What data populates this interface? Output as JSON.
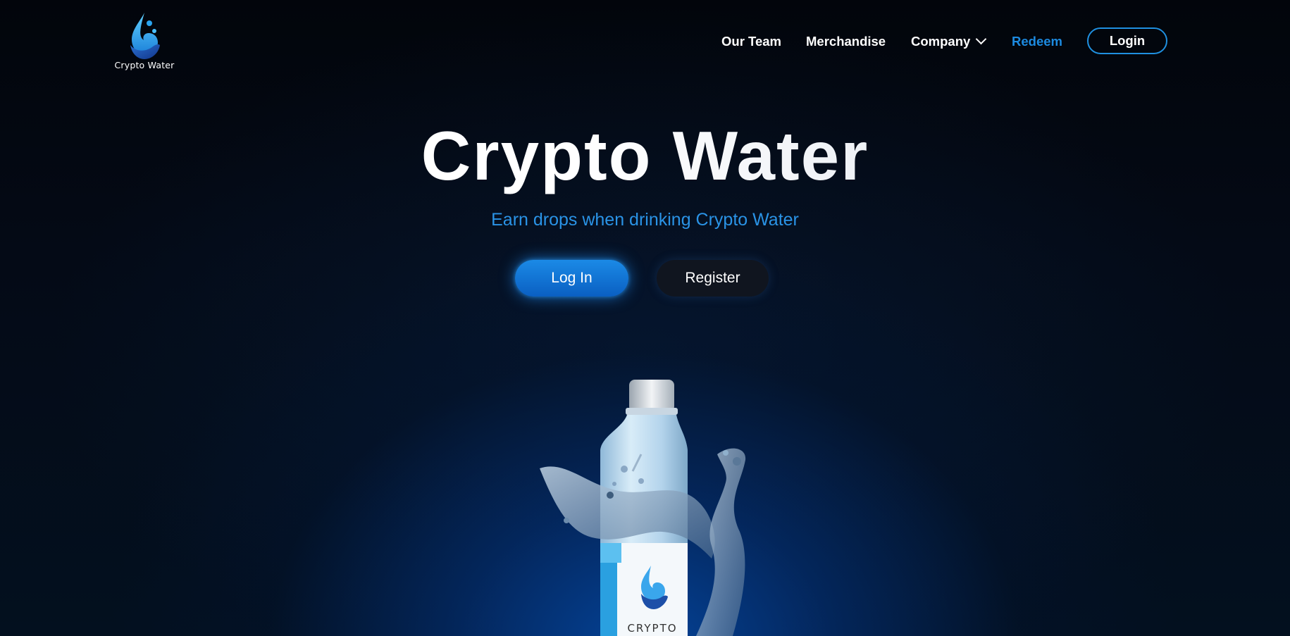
{
  "brand": {
    "name": "Crypto Water",
    "logo_icon": "water-drop-logo-icon",
    "accent": "#1c8ae0"
  },
  "nav": {
    "items": [
      {
        "label": "Our Team"
      },
      {
        "label": "Merchandise"
      },
      {
        "label": "Company",
        "has_dropdown": true
      },
      {
        "label": "Redeem",
        "highlighted": true
      }
    ],
    "login_label": "Login"
  },
  "hero": {
    "title": "Crypto Water",
    "subtitle": "Earn drops when drinking Crypto Water",
    "primary_button": "Log In",
    "secondary_button": "Register",
    "bottle_label_text": "CRYPTO"
  }
}
